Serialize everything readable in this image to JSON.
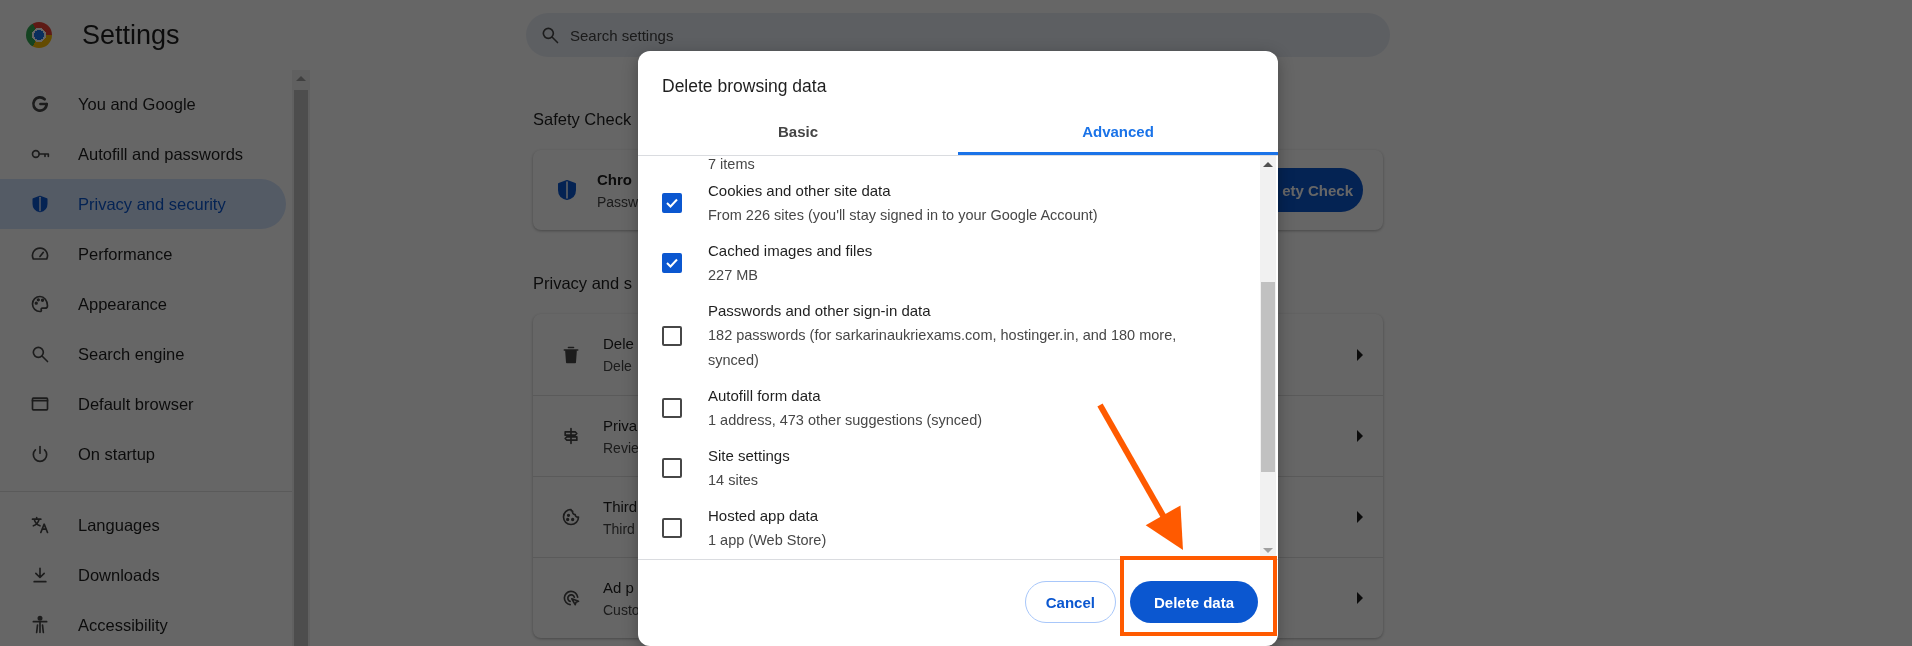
{
  "header": {
    "title": "Settings"
  },
  "search": {
    "placeholder": "Search settings"
  },
  "sidebar": {
    "items": [
      {
        "label": "You and Google",
        "selected": false
      },
      {
        "label": "Autofill and passwords",
        "selected": false
      },
      {
        "label": "Privacy and security",
        "selected": true
      },
      {
        "label": "Performance",
        "selected": false
      },
      {
        "label": "Appearance",
        "selected": false
      },
      {
        "label": "Search engine",
        "selected": false
      },
      {
        "label": "Default browser",
        "selected": false
      },
      {
        "label": "On startup",
        "selected": false
      }
    ],
    "more_items": [
      {
        "label": "Languages",
        "selected": false
      },
      {
        "label": "Downloads",
        "selected": false
      },
      {
        "label": "Accessibility",
        "selected": false
      }
    ]
  },
  "safety_check": {
    "heading": "Safety Check",
    "title": "Chro",
    "subtitle": "Passw",
    "button": "ety Check"
  },
  "privacy": {
    "heading": "Privacy and s",
    "rows": [
      {
        "title": "Dele",
        "subtitle": "Dele"
      },
      {
        "title": "Priva",
        "subtitle": "Revie"
      },
      {
        "title": "Third",
        "subtitle": "Third"
      },
      {
        "title": "Ad p",
        "subtitle": "Custo"
      }
    ]
  },
  "dialog": {
    "title": "Delete browsing data",
    "tabs": [
      {
        "label": "Basic",
        "selected": false
      },
      {
        "label": "Advanced",
        "selected": true
      }
    ],
    "scrolled_detail": "7 items",
    "items": [
      {
        "label": "Cookies and other site data",
        "details": [
          "From 226 sites (you'll stay signed in to your Google Account)"
        ],
        "checked": true
      },
      {
        "label": "Cached images and files",
        "details": [
          "227 MB"
        ],
        "checked": true
      },
      {
        "label": "Passwords and other sign-in data",
        "details": [
          "182 passwords (for sarkarinaukriexams.com, hostinger.in, and 180 more,",
          "synced)"
        ],
        "checked": false
      },
      {
        "label": "Autofill form data",
        "details": [
          "1 address, 473 other suggestions (synced)"
        ],
        "checked": false
      },
      {
        "label": "Site settings",
        "details": [
          "14 sites"
        ],
        "checked": false
      },
      {
        "label": "Hosted app data",
        "details": [
          "1 app (Web Store)"
        ],
        "checked": false
      }
    ],
    "buttons": {
      "cancel": "Cancel",
      "confirm": "Delete data"
    }
  }
}
